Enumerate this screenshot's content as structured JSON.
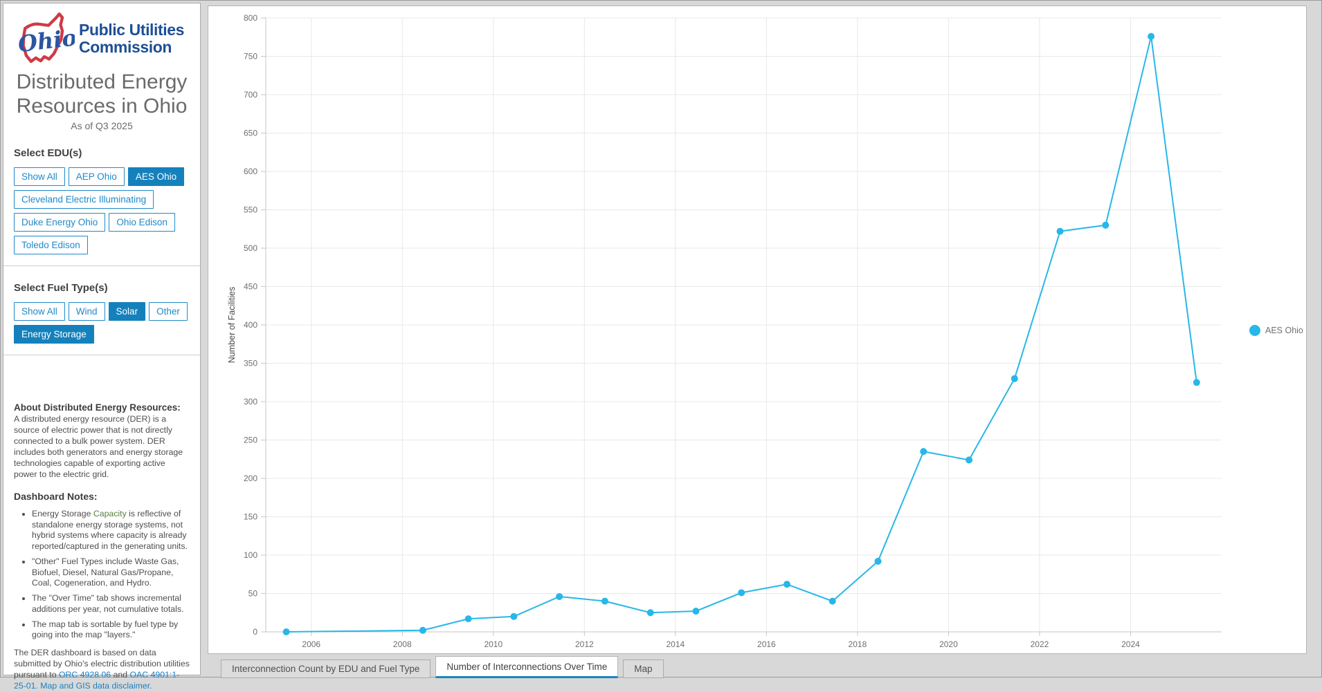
{
  "brand": {
    "logo_text": "Ohio",
    "line1": "Public Utilities",
    "line2": "Commission"
  },
  "title": {
    "main": "Distributed Energy Resources in Ohio",
    "subtitle": "As of Q3 2025"
  },
  "edu_section": {
    "label": "Select EDU(s)",
    "buttons": [
      {
        "label": "Show All",
        "selected": false
      },
      {
        "label": "AEP Ohio",
        "selected": false
      },
      {
        "label": "AES Ohio",
        "selected": true
      },
      {
        "label": "Cleveland Electric Illuminating",
        "selected": false
      },
      {
        "label": "Duke Energy Ohio",
        "selected": false
      },
      {
        "label": "Ohio Edison",
        "selected": false
      },
      {
        "label": "Toledo Edison",
        "selected": false
      }
    ]
  },
  "fuel_section": {
    "label": "Select Fuel Type(s)",
    "buttons": [
      {
        "label": "Show All",
        "selected": false
      },
      {
        "label": "Wind",
        "selected": false
      },
      {
        "label": "Solar",
        "selected": true
      },
      {
        "label": "Other",
        "selected": false
      },
      {
        "label": "Energy Storage",
        "selected": true
      }
    ]
  },
  "about": {
    "heading": "About Distributed Energy Resources:",
    "body": "A distributed energy resource (DER) is a source of electric power that is not directly connected to a bulk power system. DER includes both generators and energy storage technologies capable of exporting active power to the electric grid.",
    "notes_heading": "Dashboard Notes:",
    "bullets": {
      "b1_pre": "Energy Storage ",
      "b1_green": "Capacity",
      "b1_post": " is reflective of standalone energy storage systems, not hybrid systems where capacity is already reported/captured in the generating units.",
      "b2": "\"Other\" Fuel Types include Waste Gas, Biofuel, Diesel, Natural Gas/Propane, Coal, Cogeneration, and Hydro.",
      "b3": "The \"Over Time\" tab shows incremental additions per year, not cumulative totals.",
      "b4": "The map tab is sortable by fuel type by going into the map \"layers.\""
    },
    "footer": {
      "text_pre": "The DER dashboard is based on data submitted by Ohio's electric distribution utilities pursuant to ",
      "link_orc": "ORC 4928.06",
      "text_mid": " and ",
      "link_oac": "OAC 4901:1-25-01.",
      "link_map": " Map and GIS data disclaimer."
    }
  },
  "tabs": [
    {
      "label": "Interconnection Count by EDU and Fuel Type",
      "active": false
    },
    {
      "label": "Number of Interconnections Over Time",
      "active": true
    },
    {
      "label": "Map",
      "active": false
    }
  ],
  "theme": {
    "accent_blue": "#1481bc",
    "button_outline_blue": "#2089c9",
    "brand_navy": "#1d4f94",
    "brand_red": "#ce3b47",
    "series_cyan": "#27b7e8",
    "link_blue": "#1b7fc3",
    "note_green": "#55813f"
  },
  "chart_data": {
    "type": "line",
    "title": "",
    "xlabel": "",
    "ylabel": "Number of Facilities",
    "ylim": [
      0,
      800
    ],
    "ytick_step": 50,
    "xlim": [
      2005,
      2026
    ],
    "xticks": [
      2006,
      2008,
      2010,
      2012,
      2014,
      2016,
      2018,
      2020,
      2022,
      2024
    ],
    "grid": true,
    "legend_position": "right",
    "series": [
      {
        "name": "AES Ohio",
        "color": "#27b7e8",
        "x": [
          2005,
          2008,
          2009,
          2010,
          2011,
          2012,
          2013,
          2014,
          2015,
          2016,
          2017,
          2018,
          2019,
          2020,
          2021,
          2022,
          2023,
          2024,
          2025
        ],
        "values": [
          0,
          2,
          17,
          20,
          46,
          40,
          25,
          27,
          51,
          62,
          40,
          92,
          235,
          224,
          330,
          522,
          530,
          776,
          325
        ]
      }
    ]
  }
}
